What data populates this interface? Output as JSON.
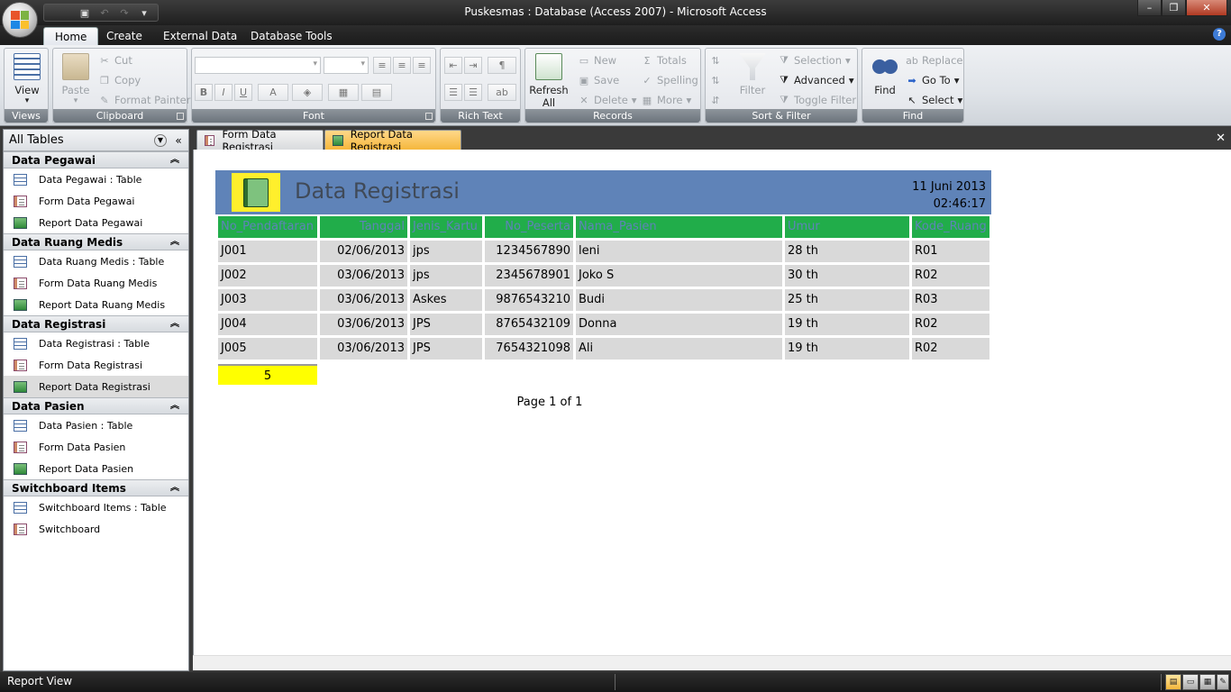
{
  "window": {
    "title": "Puskesmas : Database (Access 2007) - Microsoft Access",
    "minimize": "–",
    "maximize": "❐",
    "close": "✕"
  },
  "quick_access": {
    "save": "▣",
    "undo": "↶",
    "redo": "↷",
    "customize": "▾"
  },
  "ribbon_tabs": [
    "Home",
    "Create",
    "External Data",
    "Database Tools"
  ],
  "ribbon": {
    "views": {
      "label": "Views",
      "view": "View",
      "view_arrow": "▾"
    },
    "clipboard": {
      "label": "Clipboard",
      "paste": "Paste",
      "paste_arrow": "▾",
      "cut": "Cut",
      "copy": "Copy",
      "format_painter": "Format Painter"
    },
    "font": {
      "label": "Font",
      "bold": "B",
      "italic": "I",
      "underline": "U",
      "font_color": "A"
    },
    "rich_text": {
      "label": "Rich Text"
    },
    "records": {
      "label": "Records",
      "refresh": "Refresh",
      "refresh_sub": "All",
      "new": "New",
      "save": "Save",
      "delete": "Delete",
      "totals": "Totals",
      "spelling": "Spelling",
      "more": "More"
    },
    "sort_filter": {
      "label": "Sort & Filter",
      "filter": "Filter",
      "selection": "Selection",
      "advanced": "Advanced",
      "toggle_filter": "Toggle Filter"
    },
    "find": {
      "label": "Find",
      "find": "Find",
      "replace": "Replace",
      "goto": "Go To",
      "select": "Select"
    }
  },
  "nav": {
    "header": "All Tables",
    "groups": [
      {
        "title": "Data Pegawai",
        "items": [
          "Data Pegawai : Table",
          "Form Data Pegawai",
          "Report Data Pegawai"
        ]
      },
      {
        "title": "Data Ruang Medis",
        "items": [
          "Data Ruang Medis : Table",
          "Form Data Ruang Medis",
          "Report Data Ruang Medis"
        ]
      },
      {
        "title": "Data Registrasi",
        "items": [
          "Data Registrasi : Table",
          "Form Data Registrasi",
          "Report Data Registrasi"
        ]
      },
      {
        "title": "Data Pasien",
        "items": [
          "Data Pasien : Table",
          "Form Data Pasien",
          "Report Data Pasien"
        ]
      },
      {
        "title": "Switchboard Items",
        "items": [
          "Switchboard Items : Table",
          "Switchboard"
        ]
      }
    ]
  },
  "doc_tabs": [
    "Form Data Registrasi",
    "Report Data Registrasi"
  ],
  "report": {
    "title": "Data Registrasi",
    "date": "11 Juni 2013",
    "time": "02:46:17",
    "columns": [
      "No_Pendaftaran",
      "Tanggal",
      "Jenis_Kartu",
      "No_Peserta",
      "Nama_Pasien",
      "Umur",
      "Kode_Ruang"
    ],
    "rows": [
      [
        "J001",
        "02/06/2013",
        "jps",
        "1234567890",
        "leni",
        "28 th",
        "R01"
      ],
      [
        "J002",
        "03/06/2013",
        "jps",
        "2345678901",
        "Joko S",
        "30 th",
        "R02"
      ],
      [
        "J003",
        "03/06/2013",
        "Askes",
        "9876543210",
        "Budi",
        "25 th",
        "R03"
      ],
      [
        "J004",
        "03/06/2013",
        "JPS",
        "8765432109",
        "Donna",
        "19 th",
        "R02"
      ],
      [
        "J005",
        "03/06/2013",
        "JPS",
        "7654321098",
        "Ali",
        "19 th",
        "R02"
      ]
    ],
    "total_count": "5",
    "page": "Page 1 of 1"
  },
  "status": {
    "text": "Report View"
  },
  "colors": {
    "report_header": "#5f83b8",
    "column_header": "#21ad4a",
    "row_fill": "#d9d9d9",
    "total_fill": "#ffff00",
    "active_tab": "#f5b73c"
  }
}
